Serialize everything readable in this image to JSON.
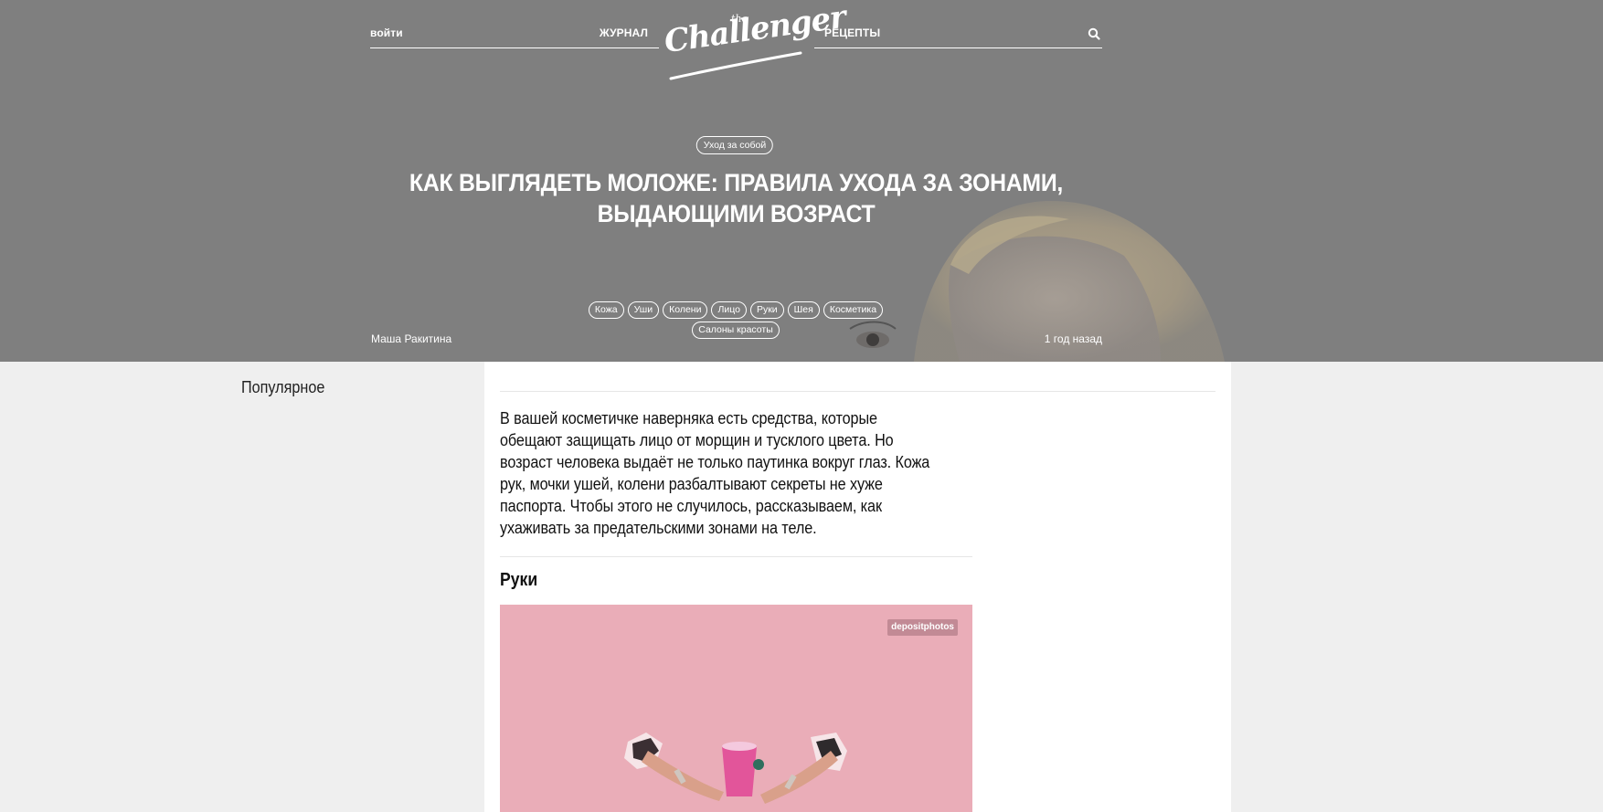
{
  "nav": {
    "login": "войти",
    "journal": "ЖУРНАЛ",
    "recipes": "РЕЦЕПТЫ",
    "search_icon": "search-icon"
  },
  "logo": {
    "small": "the",
    "main": "Challenger"
  },
  "hero": {
    "category": "Уход за собой",
    "title": "КАК ВЫГЛЯДЕТЬ МОЛОЖЕ: ПРАВИЛА УХОДА ЗА ЗОНАМИ, ВЫДАЮЩИМИ ВОЗРАСТ",
    "tags": [
      "Кожа",
      "Уши",
      "Колени",
      "Лицо",
      "Руки",
      "Шея",
      "Косметика",
      "Салоны красоты"
    ],
    "author": "Маша Ракитина",
    "date": "1 год назад"
  },
  "sidebar": {
    "title": "Популярное"
  },
  "article": {
    "lead": "В вашей косметичке наверняка есть средства, которые обещают защищать лицо от морщин и тусклого цвета. Но возраст человека выдаёт не только паутинка вокруг глаз. Кожа рук, мочки ушей, колени разбалтывают секреты не хуже паспорта. Чтобы этого не случилось, рассказываем, как ухаживать за предательскими зонами на теле.",
    "section_title": "Руки",
    "photo_credit": "depositphotos"
  },
  "colors": {
    "hero_overlay": "#7f7f7f",
    "page_bg": "#efefef",
    "photo_bg": "#eaadb8"
  }
}
